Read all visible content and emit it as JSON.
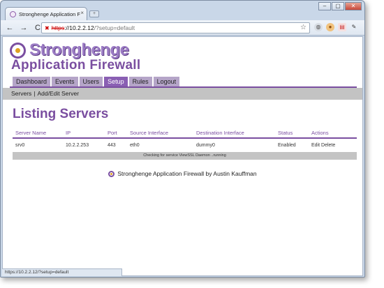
{
  "browser": {
    "tab_title": "Stronghenge Application Fi",
    "tab_close": "×",
    "new_tab": "+",
    "controls": {
      "minimize": "–",
      "maximize": "▢",
      "close": "✕"
    },
    "nav": {
      "back": "←",
      "forward": "→",
      "reload": "C"
    },
    "url": {
      "scheme": "https",
      "host": "://10.2.2.12",
      "rest": "/?setup=default"
    },
    "status_url": "https://10.2.2.12/?setup=default"
  },
  "app": {
    "logo_text": "Stronghenge",
    "title": "Application Firewall",
    "menu": [
      {
        "label": "Dashboard",
        "active": false
      },
      {
        "label": "Events",
        "active": false
      },
      {
        "label": "Users",
        "active": false
      },
      {
        "label": "Setup",
        "active": true
      },
      {
        "label": "Rules",
        "active": false
      },
      {
        "label": "Logout",
        "active": false
      }
    ],
    "subnav": {
      "item1": "Servers",
      "separator": "|",
      "item2": "Add/Edit Server"
    },
    "heading": "Listing Servers",
    "table": {
      "headers": [
        "Server Name",
        "IP",
        "Port",
        "Source Interface",
        "Destination Interface",
        "Status",
        "Actions"
      ],
      "rows": [
        {
          "name": "srv0",
          "ip": "10.2.2.253",
          "port": "443",
          "src": "eth0",
          "dst": "dummy0",
          "status": "Enabled",
          "edit": "Edit",
          "delete": "Delete"
        }
      ],
      "status_message": "Checking for service ViewSSL Daemon ..running"
    },
    "footer": "Stronghenge Application Firewall by Austin Kauffman"
  },
  "colors": {
    "accent": "#7a4ea0",
    "menu_bg": "#b5a5c8",
    "menu_active": "#8a5fb3",
    "subbar": "#c3c3c3"
  }
}
